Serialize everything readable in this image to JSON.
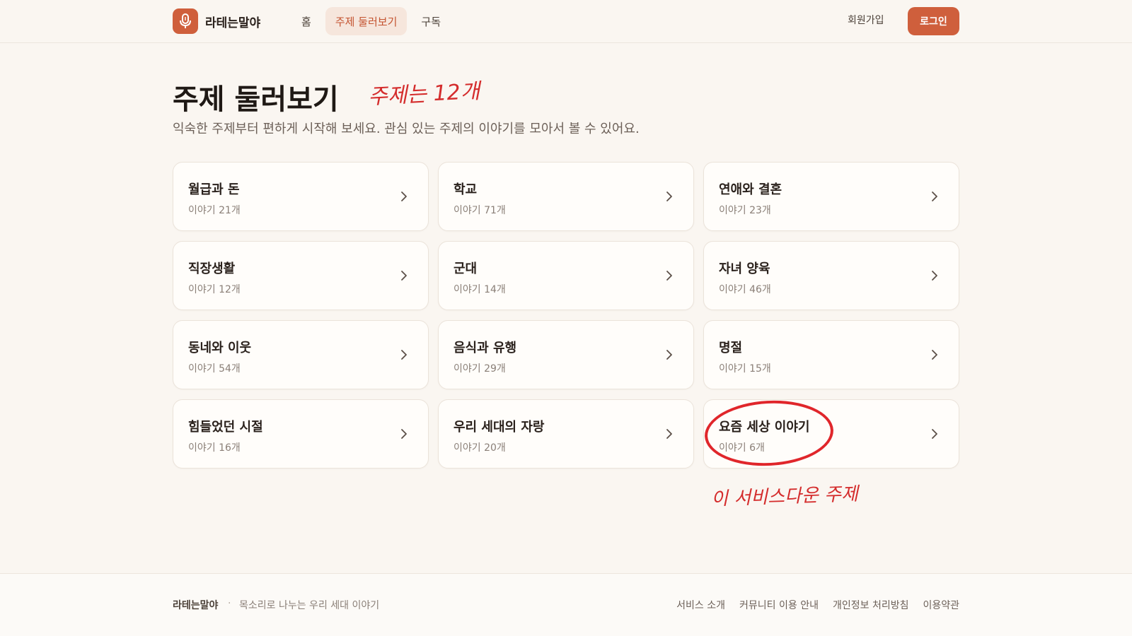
{
  "header": {
    "logo_text": "라테는말야",
    "nav": [
      "홈",
      "주제 둘러보기",
      "구독"
    ],
    "active_nav": 1,
    "signup": "회원가입",
    "login": "로그인"
  },
  "page": {
    "title": "주제 둘러보기",
    "subtitle": "익숙한 주제부터 편하게 시작해 보세요. 관심 있는 주제의 이야기를 모아서 볼 수 있어요."
  },
  "annotations": {
    "count_note": "주제는 12개",
    "service_note": "이 서비스다운 주제"
  },
  "topics": [
    {
      "title": "월급과 돈",
      "count": "이야기 21개"
    },
    {
      "title": "학교",
      "count": "이야기 71개"
    },
    {
      "title": "연애와 결혼",
      "count": "이야기 23개"
    },
    {
      "title": "직장생활",
      "count": "이야기 12개"
    },
    {
      "title": "군대",
      "count": "이야기 14개"
    },
    {
      "title": "자녀 양육",
      "count": "이야기 46개"
    },
    {
      "title": "동네와 이웃",
      "count": "이야기 54개"
    },
    {
      "title": "음식과 유행",
      "count": "이야기 29개"
    },
    {
      "title": "명절",
      "count": "이야기 15개"
    },
    {
      "title": "힘들었던 시절",
      "count": "이야기 16개"
    },
    {
      "title": "우리 세대의 자랑",
      "count": "이야기 20개"
    },
    {
      "title": "요즘 세상 이야기",
      "count": "이야기 6개"
    }
  ],
  "footer": {
    "brand": "라테는말야",
    "separator": "·",
    "tagline": "목소리로 나누는 우리 세대 이야기",
    "links": [
      "서비스 소개",
      "커뮤니티 이용 안내",
      "개인정보 처리방침",
      "이용약관"
    ]
  },
  "colors": {
    "accent": "#cf5f3c",
    "annotation": "#d42c2c",
    "background": "#faf6f1"
  },
  "icons": {
    "logo": "microphone-icon",
    "card_arrow": "chevron-right-icon"
  }
}
